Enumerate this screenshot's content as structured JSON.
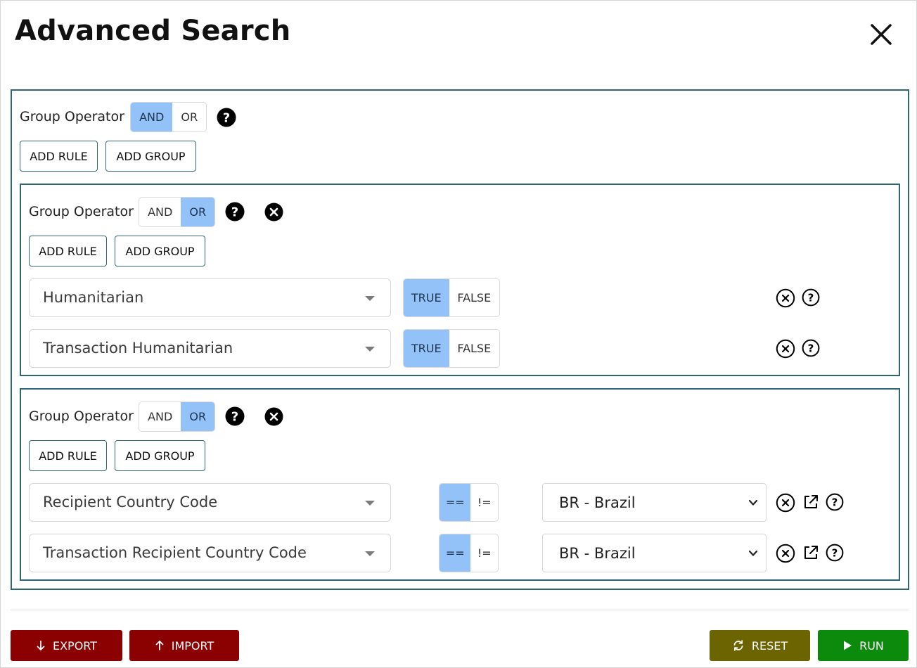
{
  "dialog": {
    "title": "Advanced Search"
  },
  "root_group": {
    "operator_label": "Group Operator",
    "operators": [
      "AND",
      "OR"
    ],
    "selected_operator": "AND",
    "add_rule_label": "ADD RULE",
    "add_group_label": "ADD GROUP"
  },
  "groups": [
    {
      "operator_label": "Group Operator",
      "operators": [
        "AND",
        "OR"
      ],
      "selected_operator": "OR",
      "add_rule_label": "ADD RULE",
      "add_group_label": "ADD GROUP",
      "rules": [
        {
          "field": "Humanitarian",
          "options": [
            "TRUE",
            "FALSE"
          ],
          "selected": "TRUE"
        },
        {
          "field": "Transaction Humanitarian",
          "options": [
            "TRUE",
            "FALSE"
          ],
          "selected": "TRUE"
        }
      ]
    },
    {
      "operator_label": "Group Operator",
      "operators": [
        "AND",
        "OR"
      ],
      "selected_operator": "OR",
      "add_rule_label": "ADD RULE",
      "add_group_label": "ADD GROUP",
      "rules": [
        {
          "field": "Recipient Country Code",
          "comparators": [
            "==",
            "!="
          ],
          "selected": "==",
          "value": "BR - Brazil"
        },
        {
          "field": "Transaction Recipient Country Code",
          "comparators": [
            "==",
            "!="
          ],
          "selected": "==",
          "value": "BR - Brazil"
        }
      ]
    }
  ],
  "footer": {
    "export_label": "EXPORT",
    "import_label": "IMPORT",
    "reset_label": "RESET",
    "run_label": "RUN"
  },
  "colors": {
    "group_border": "#2f6673",
    "segment_selected": "#93c2f8",
    "export_import": "#8b0000",
    "reset": "#6b6400",
    "run": "#0b8a0b"
  },
  "icons": {
    "close": "close-icon",
    "help": "help-circle-icon",
    "remove": "remove-circle-icon",
    "open_external": "open-external-icon",
    "arrow_down": "arrow-down-icon",
    "arrow_up": "arrow-up-icon",
    "refresh": "refresh-icon",
    "play": "play-icon"
  }
}
